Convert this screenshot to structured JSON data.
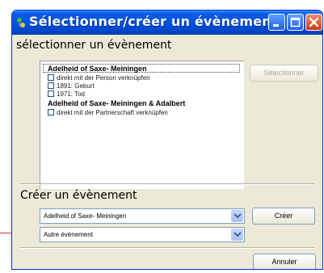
{
  "window": {
    "title": "Sélectionner/créer un évènement"
  },
  "select_section": {
    "heading": "sélectionner un évènement",
    "groups": [
      {
        "label": "Adelheid of Saxe- Meiningen",
        "items": [
          "direkt mit der Person verknüpfen",
          "1891: Geburt",
          "1971: Tod"
        ]
      },
      {
        "label": "Adelheid of Saxe- Meiningen  & Adalbert",
        "items": [
          "direkt mit der Partnerschaft verknüpfen"
        ]
      }
    ],
    "select_button": "Sélectionner"
  },
  "create_section": {
    "heading": "Créer un évènement",
    "person_combo": "Adelheid of Saxe- Meiningen",
    "event_combo": "Autre évènement",
    "create_button": "Créer"
  },
  "footer": {
    "cancel_button": "Annuler"
  },
  "colors": {
    "titlebar": "#0052e0",
    "dialog_bg": "#ece9d8",
    "close_button": "#d43a12"
  }
}
